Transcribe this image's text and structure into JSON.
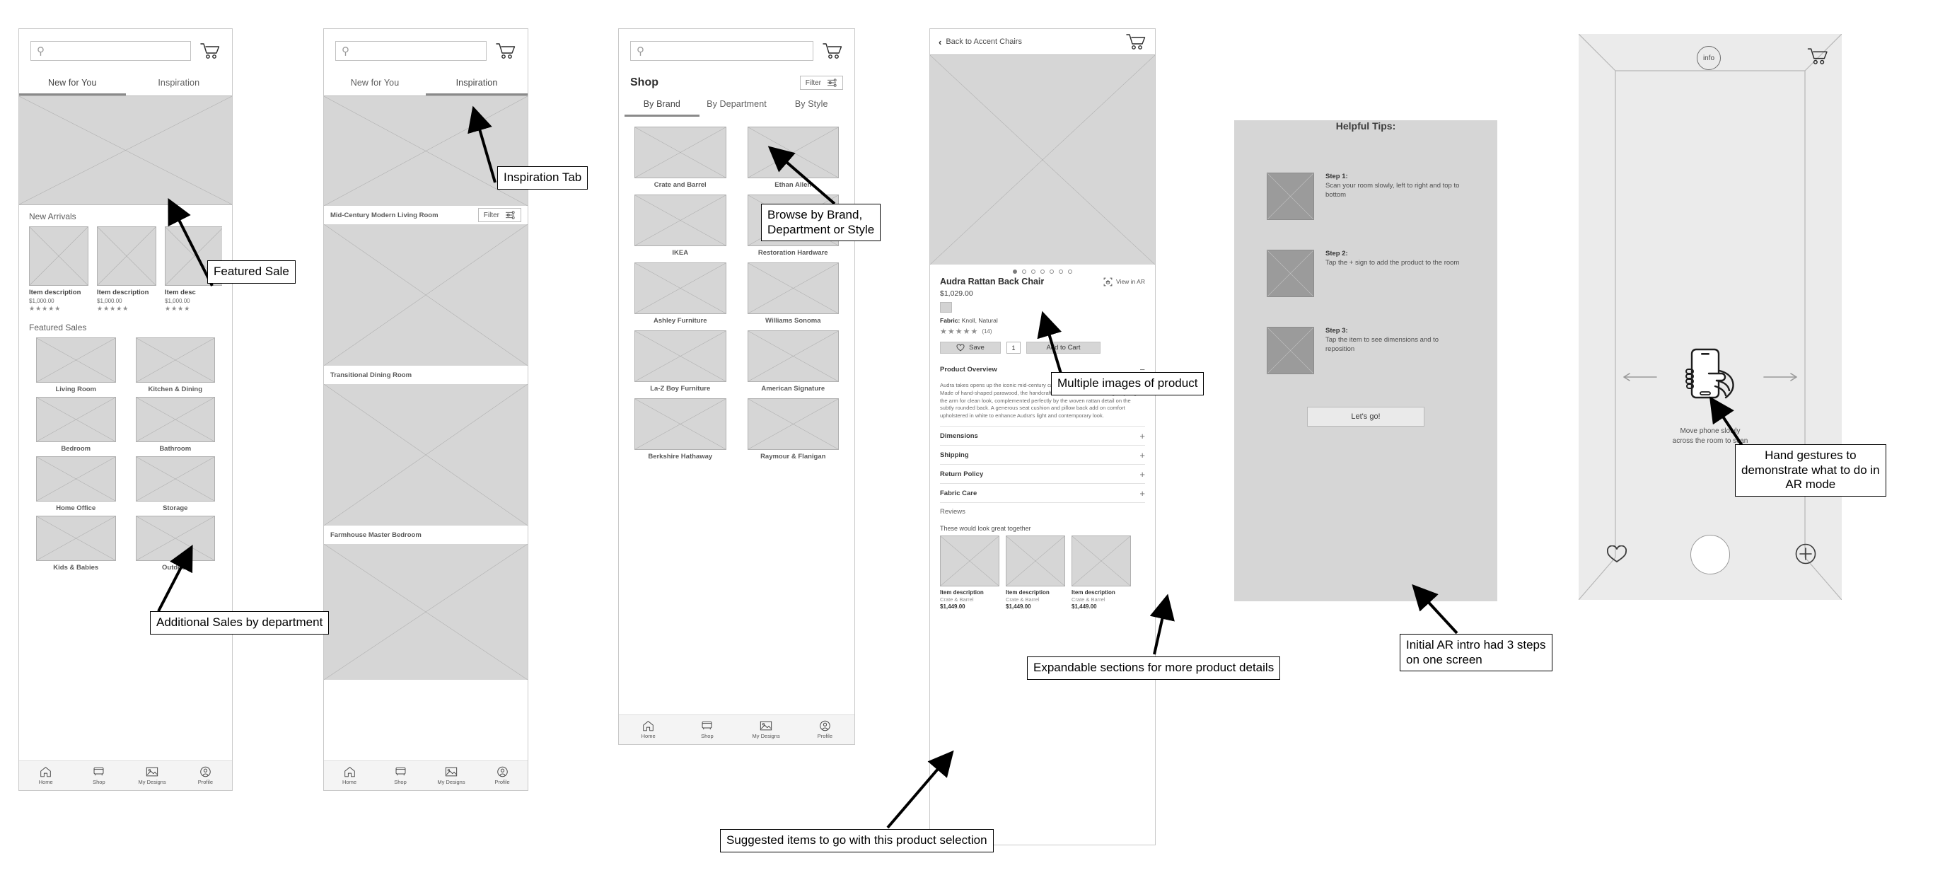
{
  "common": {
    "search_placeholder": "",
    "cart_icon": "cart-icon",
    "search_icon": "search-icon",
    "bottom_nav": [
      {
        "label": "Home",
        "icon": "home-icon"
      },
      {
        "label": "Shop",
        "icon": "armchair-icon"
      },
      {
        "label": "My Designs",
        "icon": "image-icon"
      },
      {
        "label": "Profile",
        "icon": "profile-icon"
      }
    ],
    "filter_label": "Filter",
    "stars_full": "★★★★★",
    "stars_partial": "★★★★"
  },
  "screen1": {
    "tabs": [
      {
        "label": "New for You",
        "active": true
      },
      {
        "label": "Inspiration",
        "active": false
      }
    ],
    "new_arrivals_title": "New Arrivals",
    "new_arrivals": [
      {
        "name": "Item description",
        "price": "$1,000.00",
        "rating": "★★★★★"
      },
      {
        "name": "Item description",
        "price": "$1,000.00",
        "rating": "★★★★★"
      },
      {
        "name": "Item desc",
        "price": "$1,000.00",
        "rating": "★★★★"
      }
    ],
    "featured_sales_title": "Featured Sales",
    "departments": [
      "Living Room",
      "Kitchen & Dining",
      "Bedroom",
      "Bathroom",
      "Home Office",
      "Storage",
      "Kids & Babies",
      "Outdoor"
    ]
  },
  "screen2": {
    "tabs": [
      {
        "label": "New for You",
        "active": false
      },
      {
        "label": "Inspiration",
        "active": true
      }
    ],
    "rooms": [
      {
        "label": "Mid-Century Modern Living Room",
        "has_filter": true
      },
      {
        "label": "Transitional Dining Room",
        "has_filter": false
      },
      {
        "label": "Farmhouse Master Bedroom",
        "has_filter": false
      }
    ]
  },
  "screen3": {
    "page_title": "Shop",
    "filter_label": "Filter",
    "tabs": [
      {
        "label": "By Brand",
        "active": true
      },
      {
        "label": "By Department",
        "active": false
      },
      {
        "label": "By Style",
        "active": false
      }
    ],
    "brands": [
      "Crate and Barrel",
      "Ethan Allen",
      "IKEA",
      "Restoration Hardware",
      "Ashley Furniture",
      "Williams Sonoma",
      "La-Z Boy Furniture",
      "American Signature",
      "Berkshire Hathaway",
      "Raymour & Flanigan"
    ]
  },
  "screen4": {
    "back_label": "Back to Accent Chairs",
    "carousel_dots": 7,
    "carousel_active_index": 0,
    "title": "Audra Rattan Back Chair",
    "view_in_ar": "View in AR",
    "ar_icon": "ar-cube-icon",
    "price": "$1,029.00",
    "fabric_label": "Fabric:",
    "fabric_value": "Knoll, Natural",
    "rating_stars": "★★★★★",
    "review_count": "(14)",
    "save_label": "Save",
    "heart_icon": "heart-icon",
    "quantity": "1",
    "add_to_cart_label": "Add to Cart",
    "overview_label": "Product Overview",
    "overview_toggle": "−",
    "overview_text": "Audra takes opens up the iconic mid-century cane back chair to modern living spaces. Made of hand-shaped parawood, the handcrafted frame edits down and gently angles the arm for clean look, complemented perfectly by the woven rattan detail on the subtly rounded back. A generous seat cushion and pillow back add on comfort upholstered in white to enhance Audra's light and contemporary look.",
    "accordions": [
      {
        "label": "Dimensions",
        "toggle": "+"
      },
      {
        "label": "Shipping",
        "toggle": "+"
      },
      {
        "label": "Return Policy",
        "toggle": "+"
      },
      {
        "label": "Fabric Care",
        "toggle": "+"
      },
      {
        "label": "Reviews",
        "toggle": ""
      }
    ],
    "suggested_title": "These would look great together",
    "suggested": [
      {
        "name": "Item description",
        "brand": "Crate & Barrel",
        "price": "$1,449.00"
      },
      {
        "name": "Item description",
        "brand": "Crate & Barrel",
        "price": "$1,449.00"
      },
      {
        "name": "Item description",
        "brand": "Crate & Barrel",
        "price": "$1,449.00"
      }
    ]
  },
  "screen5": {
    "heading": "Helpful Tips:",
    "steps": [
      {
        "title": "Step 1:",
        "desc": "Scan your room slowly, left to right and top to bottom"
      },
      {
        "title": "Step 2:",
        "desc": "Tap the + sign to add the product to the room"
      },
      {
        "title": "Step 3:",
        "desc": "Tap the item to see dimensions and to reposition"
      }
    ],
    "cta_label": "Let's go!"
  },
  "screen6": {
    "info_label": "info",
    "caption": "Move phone slowly\nacross the room to scan",
    "phone_hand_icon": "phone-in-hand-icon",
    "left_arrow_icon": "arrow-left-icon",
    "right_arrow_icon": "arrow-right-icon",
    "heart_icon": "heart-icon",
    "shutter_icon": "shutter-button",
    "plus_icon": "plus-circle-icon",
    "cart_icon": "cart-icon"
  },
  "annotations": [
    {
      "id": "featured-sale",
      "text": "Featured Sale"
    },
    {
      "id": "inspiration-tab",
      "text": "Inspiration Tab"
    },
    {
      "id": "browse-by",
      "text": "Browse by Brand,\nDepartment or Style"
    },
    {
      "id": "multiple-images",
      "text": "Multiple images of product"
    },
    {
      "id": "hand-gestures",
      "text": "Hand gestures to\ndemonstrate what to do in\nAR mode"
    },
    {
      "id": "additional-sales",
      "text": "Additional Sales by department"
    },
    {
      "id": "expandable-sections",
      "text": "Expandable sections for more product details"
    },
    {
      "id": "initial-ar-intro",
      "text": "Initial AR intro had 3 steps\non one screen"
    },
    {
      "id": "suggested-items",
      "text": "Suggested items to go with this product selection"
    }
  ]
}
